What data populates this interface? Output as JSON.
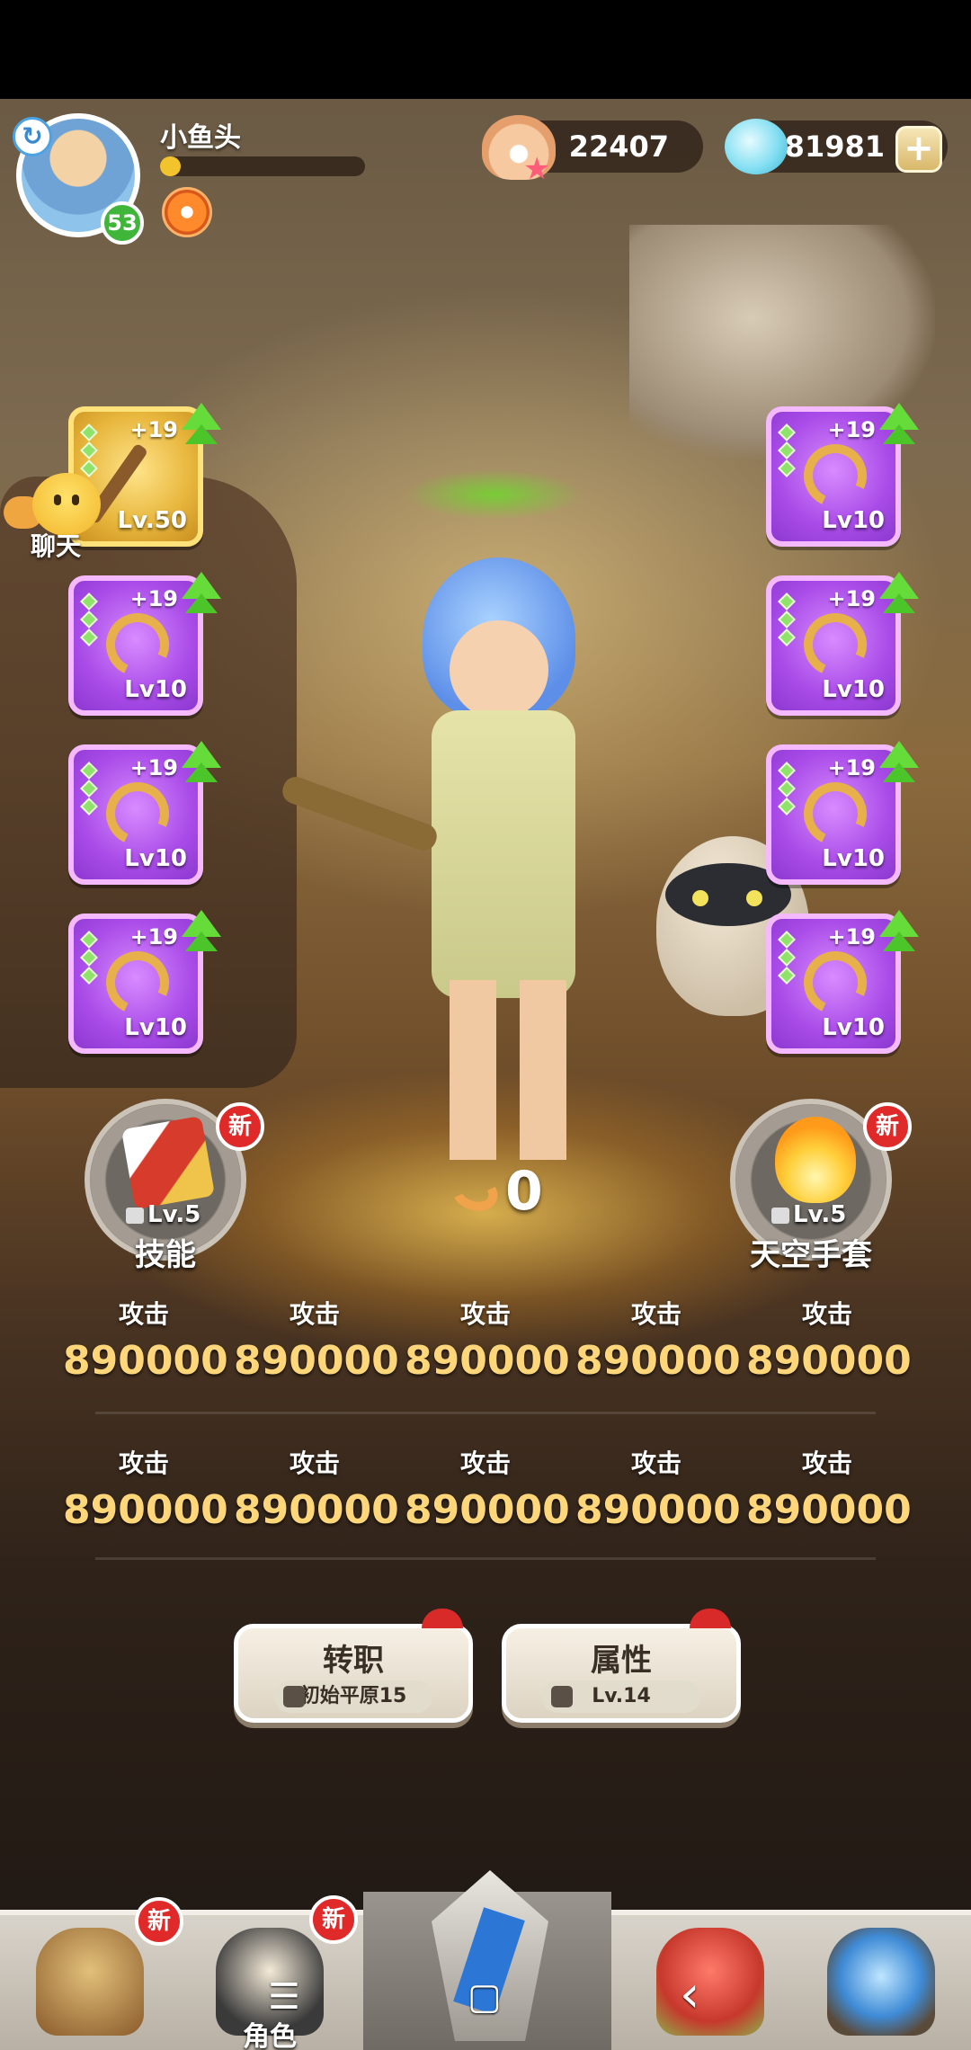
{
  "player": {
    "name": "小鱼头",
    "level": "53",
    "exp_fraction": 0.1
  },
  "currency": {
    "shells": "22407",
    "gems": "781981",
    "plus": "+"
  },
  "equipment": {
    "left": [
      {
        "plus": "+19",
        "level": "Lv.50",
        "type": "staff"
      },
      {
        "plus": "+19",
        "level": "Lv10",
        "type": "ring"
      },
      {
        "plus": "+19",
        "level": "Lv10",
        "type": "ring"
      },
      {
        "plus": "+19",
        "level": "Lv10",
        "type": "ring"
      }
    ],
    "right": [
      {
        "plus": "+19",
        "level": "Lv10",
        "type": "ring"
      },
      {
        "plus": "+19",
        "level": "Lv10",
        "type": "ring"
      },
      {
        "plus": "+19",
        "level": "Lv10",
        "type": "ring"
      },
      {
        "plus": "+19",
        "level": "Lv10",
        "type": "ring"
      }
    ]
  },
  "chat": {
    "label": "聊天"
  },
  "power": {
    "value": "0"
  },
  "skills": {
    "left": {
      "lock": "Lv.5",
      "name": "技能",
      "badge": "新"
    },
    "right": {
      "lock": "Lv.5",
      "name": "天空手套",
      "badge": "新"
    }
  },
  "stats": {
    "row1": [
      {
        "label": "攻击",
        "value": "890000"
      },
      {
        "label": "攻击",
        "value": "890000"
      },
      {
        "label": "攻击",
        "value": "890000"
      },
      {
        "label": "攻击",
        "value": "890000"
      },
      {
        "label": "攻击",
        "value": "890000"
      }
    ],
    "row2": [
      {
        "label": "攻击",
        "value": "890000"
      },
      {
        "label": "攻击",
        "value": "890000"
      },
      {
        "label": "攻击",
        "value": "890000"
      },
      {
        "label": "攻击",
        "value": "890000"
      },
      {
        "label": "攻击",
        "value": "890000"
      }
    ]
  },
  "actions": {
    "job": {
      "title": "转职",
      "sub": "初始平原15"
    },
    "attr": {
      "title": "属性",
      "sub": "Lv.14"
    }
  },
  "nav": {
    "items": [
      {
        "badge": "新",
        "label": ""
      },
      {
        "badge": "新",
        "label": "角色"
      },
      {
        "badge": "",
        "label": ""
      },
      {
        "badge": "",
        "label": ""
      },
      {
        "badge": "",
        "label": ""
      }
    ]
  },
  "system_nav": {
    "menu": "☰",
    "home": "▢",
    "back": "‹"
  },
  "colors": {
    "stat_value": "#ffd77a",
    "new_badge": "#e02a2a",
    "slot_purple": "#a94be8",
    "slot_gold": "#e7b53b"
  }
}
